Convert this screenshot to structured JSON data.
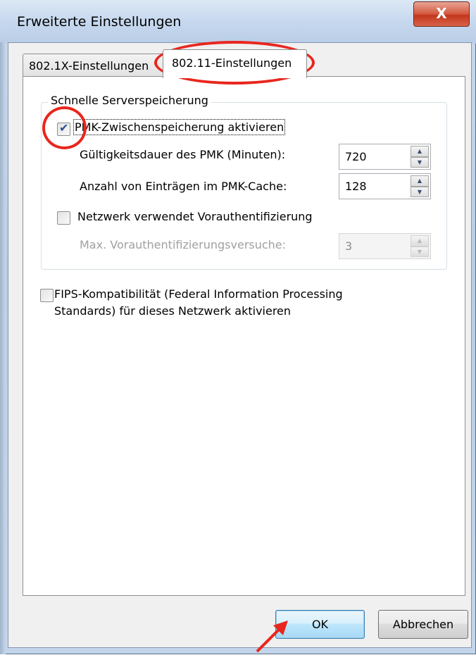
{
  "window": {
    "title": "Erweiterte Einstellungen",
    "close_label": "X"
  },
  "tabs": [
    {
      "label": "802.1X-Einstellungen",
      "active": false
    },
    {
      "label": "802.11-Einstellungen",
      "active": true
    }
  ],
  "group": {
    "label": "Schnelle Serverspeicherung",
    "pmk_caching": {
      "label": "PMK-Zwischenspeicherung aktivieren",
      "checked": true
    },
    "pmk_lifetime": {
      "label": "Gültigkeitsdauer des PMK (Minuten):",
      "value": "720"
    },
    "pmk_entries": {
      "label": "Anzahl von Einträgen im PMK-Cache:",
      "value": "128"
    },
    "preauth": {
      "label": "Netzwerk verwendet Vorauthentifizierung",
      "checked": false
    },
    "preauth_attempts": {
      "label": "Max. Vorauthentifizierungsversuche:",
      "value": "3",
      "enabled": false
    }
  },
  "fips": {
    "label_line1": "FIPS-Kompatibilität (Federal Information Processing",
    "label_line2": "Standards) für dieses Netzwerk aktivieren",
    "checked": false
  },
  "buttons": {
    "ok": "OK",
    "cancel": "Abbrechen"
  },
  "colors": {
    "annotation": "#e8261e",
    "checkmark": "#2a4f91"
  }
}
